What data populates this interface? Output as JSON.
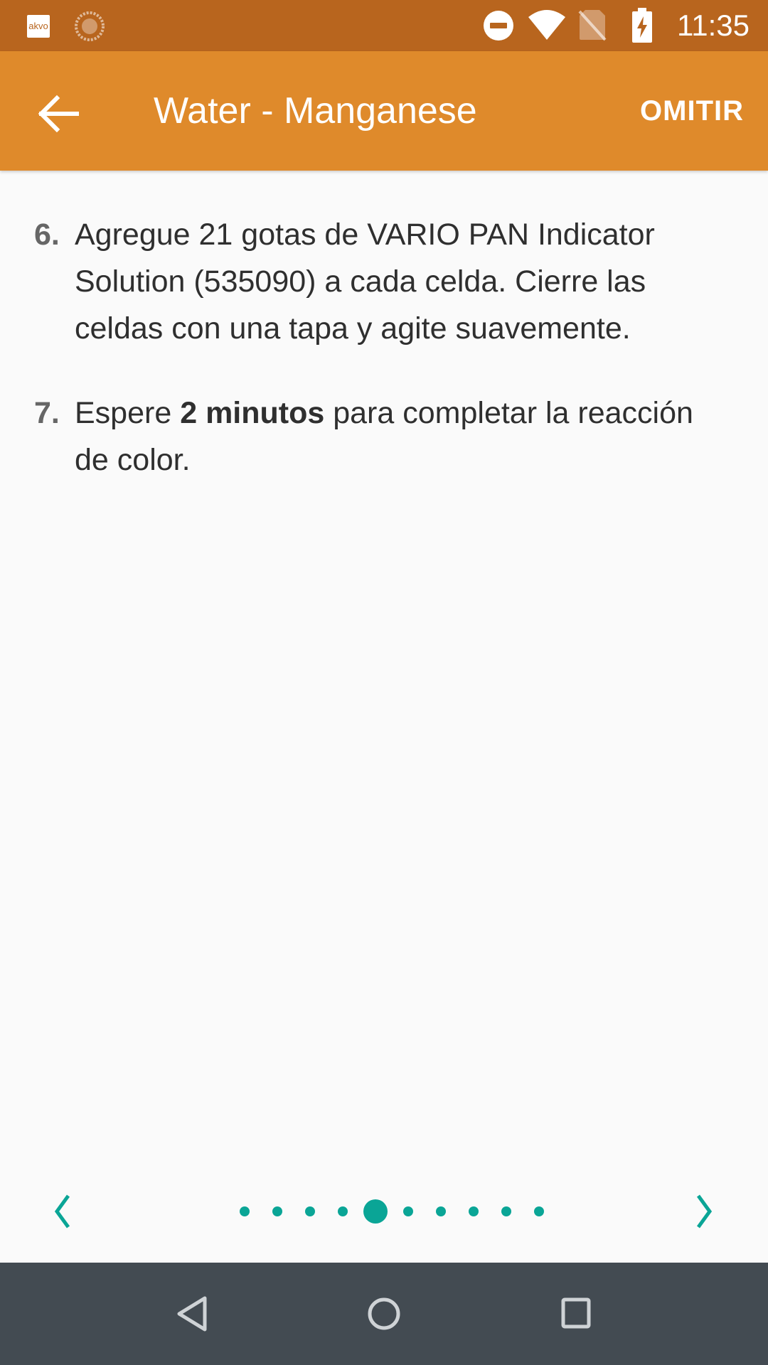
{
  "status_bar": {
    "app_badge": "akvo",
    "time": "11:35",
    "icons": [
      "akvo-icon",
      "sync-icon",
      "do-not-disturb-icon",
      "wifi-icon",
      "no-sim-icon",
      "battery-charging-icon"
    ]
  },
  "app_bar": {
    "title": "Water - Manganese",
    "skip_label": "OMITIR",
    "back_icon": "arrow-back-icon"
  },
  "steps": [
    {
      "number": "6.",
      "text": "Agregue 21 gotas de VARIO PAN Indicator Solution (535090) a cada celda. Cierre las celdas con una tapa y agite suavemente."
    },
    {
      "number": "7.",
      "text_before": "Espere ",
      "text_bold": "2 minutos",
      "text_after": " para completar la reacción de color."
    }
  ],
  "pager": {
    "total_pages": 10,
    "current_page": 5,
    "prev_icon": "chevron-left-icon",
    "next_icon": "chevron-right-icon"
  },
  "nav_bar": {
    "icons": [
      "nav-back-icon",
      "nav-home-icon",
      "nav-recent-icon"
    ]
  },
  "colors": {
    "status_bar": "#b8651e",
    "app_bar": "#df8a2b",
    "accent": "#0aa596",
    "nav_bar": "#434b52",
    "background": "#fafafa"
  }
}
